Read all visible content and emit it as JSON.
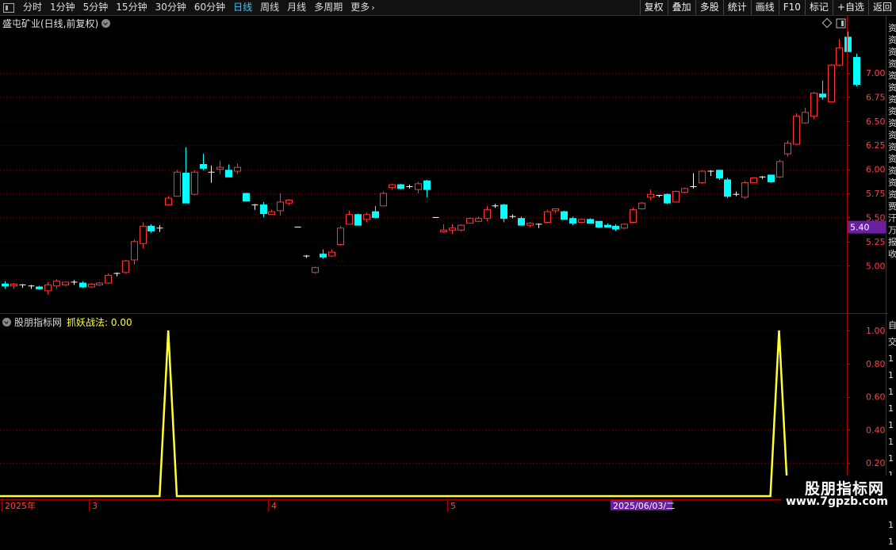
{
  "toolbar": {
    "periods": [
      "分时",
      "1分钟",
      "5分钟",
      "15分钟",
      "30分钟",
      "60分钟",
      "日线",
      "周线",
      "月线",
      "多周期",
      "更多"
    ],
    "active_period": "日线",
    "tools": [
      "复权",
      "叠加",
      "多股",
      "统计",
      "画线",
      "F10",
      "标记",
      "+自选",
      "返回"
    ]
  },
  "main_panel": {
    "title": "盛屯矿业(日线,前复权)",
    "price_axis_labels": [
      "7.00",
      "6.75",
      "6.50",
      "6.25",
      "6.00",
      "5.75",
      "5.50",
      "5.25",
      "5.00"
    ],
    "current_price_tag": "5.40"
  },
  "indicator_panel": {
    "name": "股朋指标网",
    "value_label": "抓妖战法: 0.00",
    "axis_labels": [
      "1.00",
      "0.80",
      "0.60",
      "0.40",
      "0.20"
    ]
  },
  "date_axis": {
    "labels": [
      "2025年",
      "3",
      "4",
      "5"
    ],
    "cursor_date": "2025/06/03/二"
  },
  "watermark": {
    "line1": "股朋指标网",
    "line2": "www.7gpzb.com"
  },
  "side_column": {
    "top_chars": [
      "资",
      "资",
      "资",
      "资",
      "资",
      "资",
      "资",
      "资",
      "资",
      "资",
      "资",
      "资",
      "资",
      "资",
      "资",
      "贾",
      "汗",
      "万",
      "报",
      "收"
    ],
    "indicator_chars": [
      "自",
      "交",
      "1",
      "1",
      "1",
      "1",
      "1",
      "1",
      "1",
      "1",
      "1",
      "1",
      "1",
      "1"
    ]
  },
  "colors": {
    "up": "#ff3333",
    "down": "#00ffff",
    "indicator_line": "#ffff33",
    "grid": "#5a0000",
    "axis": "#aa0000",
    "price_tag_bg": "#6a1fa0"
  },
  "chart_data": [
    {
      "type": "candlestick",
      "title": "盛屯矿业(日线,前复权)",
      "ylim": [
        4.55,
        7.55
      ],
      "y_ticks": [
        5.0,
        5.25,
        5.5,
        5.75,
        6.0,
        6.25,
        6.5,
        6.75,
        7.0
      ],
      "x_tick_labels": [
        "2025年",
        "3",
        "4",
        "5"
      ],
      "candles": [
        {
          "o": 4.81,
          "h": 4.84,
          "l": 4.76,
          "c": 4.79
        },
        {
          "o": 4.79,
          "h": 4.82,
          "l": 4.76,
          "c": 4.81
        },
        {
          "o": 4.79,
          "h": 4.81,
          "l": 4.77,
          "c": 4.8
        },
        {
          "o": 4.78,
          "h": 4.8,
          "l": 4.76,
          "c": 4.79
        },
        {
          "o": 4.78,
          "h": 4.79,
          "l": 4.75,
          "c": 4.76
        },
        {
          "o": 4.74,
          "h": 4.83,
          "l": 4.7,
          "c": 4.8
        },
        {
          "o": 4.79,
          "h": 4.86,
          "l": 4.76,
          "c": 4.84
        },
        {
          "o": 4.8,
          "h": 4.83,
          "l": 4.79,
          "c": 4.83
        },
        {
          "o": 4.83,
          "h": 4.85,
          "l": 4.8,
          "c": 4.82
        },
        {
          "o": 4.82,
          "h": 4.84,
          "l": 4.77,
          "c": 4.78
        },
        {
          "o": 4.78,
          "h": 4.82,
          "l": 4.77,
          "c": 4.81
        },
        {
          "o": 4.8,
          "h": 4.83,
          "l": 4.79,
          "c": 4.82
        },
        {
          "o": 4.82,
          "h": 4.92,
          "l": 4.81,
          "c": 4.9
        },
        {
          "o": 4.91,
          "h": 4.93,
          "l": 4.89,
          "c": 4.92
        },
        {
          "o": 4.93,
          "h": 5.06,
          "l": 4.92,
          "c": 5.05
        },
        {
          "o": 5.06,
          "h": 5.27,
          "l": 5.01,
          "c": 5.25
        },
        {
          "o": 5.23,
          "h": 5.45,
          "l": 5.18,
          "c": 5.41
        },
        {
          "o": 5.41,
          "h": 5.43,
          "l": 5.34,
          "c": 5.36
        },
        {
          "o": 5.38,
          "h": 5.42,
          "l": 5.35,
          "c": 5.39
        },
        {
          "o": 5.63,
          "h": 5.72,
          "l": 5.63,
          "c": 5.7
        },
        {
          "o": 5.72,
          "h": 5.99,
          "l": 5.72,
          "c": 5.97
        },
        {
          "o": 5.96,
          "h": 6.23,
          "l": 5.65,
          "c": 5.65
        },
        {
          "o": 5.74,
          "h": 5.99,
          "l": 5.73,
          "c": 5.97
        },
        {
          "o": 6.05,
          "h": 6.16,
          "l": 5.99,
          "c": 6.01
        },
        {
          "o": 5.97,
          "h": 6.04,
          "l": 5.86,
          "c": 5.96
        },
        {
          "o": 6.0,
          "h": 6.09,
          "l": 5.95,
          "c": 6.02
        },
        {
          "o": 5.99,
          "h": 6.05,
          "l": 5.93,
          "c": 5.92
        },
        {
          "o": 5.98,
          "h": 6.06,
          "l": 5.95,
          "c": 6.02
        },
        {
          "o": 5.75,
          "h": 5.75,
          "l": 5.67,
          "c": 5.67
        },
        {
          "o": 5.62,
          "h": 5.64,
          "l": 5.58,
          "c": 5.63
        },
        {
          "o": 5.63,
          "h": 5.66,
          "l": 5.5,
          "c": 5.54
        },
        {
          "o": 5.53,
          "h": 5.58,
          "l": 5.53,
          "c": 5.56
        },
        {
          "o": 5.57,
          "h": 5.75,
          "l": 5.52,
          "c": 5.66
        },
        {
          "o": 5.65,
          "h": 5.69,
          "l": 5.63,
          "c": 5.68
        },
        {
          "o": 5.4,
          "h": 5.4,
          "l": 5.4,
          "c": 5.4
        },
        {
          "o": 5.1,
          "h": 5.11,
          "l": 5.08,
          "c": 5.09
        },
        {
          "o": 4.93,
          "h": 4.99,
          "l": 4.92,
          "c": 4.98
        },
        {
          "o": 5.12,
          "h": 5.17,
          "l": 5.07,
          "c": 5.09
        },
        {
          "o": 5.1,
          "h": 5.17,
          "l": 5.09,
          "c": 5.14
        },
        {
          "o": 5.22,
          "h": 5.41,
          "l": 5.21,
          "c": 5.39
        },
        {
          "o": 5.43,
          "h": 5.57,
          "l": 5.43,
          "c": 5.53
        },
        {
          "o": 5.53,
          "h": 5.54,
          "l": 5.42,
          "c": 5.42
        },
        {
          "o": 5.48,
          "h": 5.55,
          "l": 5.45,
          "c": 5.53
        },
        {
          "o": 5.56,
          "h": 5.62,
          "l": 5.49,
          "c": 5.5
        },
        {
          "o": 5.62,
          "h": 5.77,
          "l": 5.62,
          "c": 5.75
        },
        {
          "o": 5.81,
          "h": 5.85,
          "l": 5.79,
          "c": 5.84
        },
        {
          "o": 5.84,
          "h": 5.85,
          "l": 5.79,
          "c": 5.8
        },
        {
          "o": 5.81,
          "h": 5.84,
          "l": 5.8,
          "c": 5.82
        },
        {
          "o": 5.79,
          "h": 5.87,
          "l": 5.75,
          "c": 5.85
        },
        {
          "o": 5.88,
          "h": 5.89,
          "l": 5.71,
          "c": 5.79
        },
        {
          "o": 5.5,
          "h": 5.5,
          "l": 5.5,
          "c": 5.5
        },
        {
          "o": 5.35,
          "h": 5.43,
          "l": 5.34,
          "c": 5.37
        },
        {
          "o": 5.37,
          "h": 5.43,
          "l": 5.33,
          "c": 5.39
        },
        {
          "o": 5.37,
          "h": 5.43,
          "l": 5.36,
          "c": 5.42
        },
        {
          "o": 5.44,
          "h": 5.5,
          "l": 5.44,
          "c": 5.49
        },
        {
          "o": 5.46,
          "h": 5.51,
          "l": 5.45,
          "c": 5.49
        },
        {
          "o": 5.49,
          "h": 5.62,
          "l": 5.46,
          "c": 5.58
        },
        {
          "o": 5.61,
          "h": 5.64,
          "l": 5.6,
          "c": 5.62
        },
        {
          "o": 5.63,
          "h": 5.64,
          "l": 5.45,
          "c": 5.49
        },
        {
          "o": 5.51,
          "h": 5.53,
          "l": 5.49,
          "c": 5.5
        },
        {
          "o": 5.49,
          "h": 5.51,
          "l": 5.42,
          "c": 5.42
        },
        {
          "o": 5.42,
          "h": 5.45,
          "l": 5.4,
          "c": 5.44
        },
        {
          "o": 5.43,
          "h": 5.44,
          "l": 5.39,
          "c": 5.42
        },
        {
          "o": 5.45,
          "h": 5.58,
          "l": 5.44,
          "c": 5.56
        },
        {
          "o": 5.57,
          "h": 5.59,
          "l": 5.55,
          "c": 5.59
        },
        {
          "o": 5.56,
          "h": 5.57,
          "l": 5.48,
          "c": 5.48
        },
        {
          "o": 5.49,
          "h": 5.51,
          "l": 5.42,
          "c": 5.44
        },
        {
          "o": 5.45,
          "h": 5.49,
          "l": 5.44,
          "c": 5.48
        },
        {
          "o": 5.48,
          "h": 5.49,
          "l": 5.44,
          "c": 5.44
        },
        {
          "o": 5.46,
          "h": 5.46,
          "l": 5.39,
          "c": 5.4
        },
        {
          "o": 5.42,
          "h": 5.44,
          "l": 5.4,
          "c": 5.4
        },
        {
          "o": 5.41,
          "h": 5.43,
          "l": 5.36,
          "c": 5.38
        },
        {
          "o": 5.39,
          "h": 5.44,
          "l": 5.38,
          "c": 5.43
        },
        {
          "o": 5.45,
          "h": 5.6,
          "l": 5.44,
          "c": 5.58
        },
        {
          "o": 5.59,
          "h": 5.66,
          "l": 5.58,
          "c": 5.65
        },
        {
          "o": 5.71,
          "h": 5.79,
          "l": 5.68,
          "c": 5.74
        },
        {
          "o": 5.72,
          "h": 5.73,
          "l": 5.71,
          "c": 5.73
        },
        {
          "o": 5.74,
          "h": 5.75,
          "l": 5.64,
          "c": 5.65
        },
        {
          "o": 5.66,
          "h": 5.78,
          "l": 5.66,
          "c": 5.77
        },
        {
          "o": 5.76,
          "h": 5.81,
          "l": 5.75,
          "c": 5.8
        },
        {
          "o": 5.81,
          "h": 5.96,
          "l": 5.8,
          "c": 5.82
        },
        {
          "o": 5.86,
          "h": 5.99,
          "l": 5.85,
          "c": 5.98
        },
        {
          "o": 5.97,
          "h": 5.99,
          "l": 5.93,
          "c": 5.98
        },
        {
          "o": 5.99,
          "h": 5.99,
          "l": 5.89,
          "c": 5.91
        },
        {
          "o": 5.89,
          "h": 5.91,
          "l": 5.7,
          "c": 5.72
        },
        {
          "o": 5.74,
          "h": 5.77,
          "l": 5.72,
          "c": 5.74
        },
        {
          "o": 5.71,
          "h": 5.88,
          "l": 5.69,
          "c": 5.86
        },
        {
          "o": 5.86,
          "h": 5.92,
          "l": 5.86,
          "c": 5.91
        },
        {
          "o": 5.91,
          "h": 5.93,
          "l": 5.9,
          "c": 5.92
        },
        {
          "o": 5.94,
          "h": 5.94,
          "l": 5.86,
          "c": 5.87
        },
        {
          "o": 5.92,
          "h": 6.1,
          "l": 5.91,
          "c": 6.08
        },
        {
          "o": 6.16,
          "h": 6.3,
          "l": 6.13,
          "c": 6.27
        },
        {
          "o": 6.26,
          "h": 6.58,
          "l": 6.25,
          "c": 6.55
        },
        {
          "o": 6.48,
          "h": 6.64,
          "l": 6.47,
          "c": 6.59
        },
        {
          "o": 6.55,
          "h": 6.8,
          "l": 6.52,
          "c": 6.79
        },
        {
          "o": 6.78,
          "h": 6.92,
          "l": 6.72,
          "c": 6.75
        },
        {
          "o": 6.7,
          "h": 7.09,
          "l": 6.7,
          "c": 7.08
        },
        {
          "o": 7.08,
          "h": 7.35,
          "l": 7.07,
          "c": 7.26
        },
        {
          "o": 7.37,
          "h": 7.43,
          "l": 7.22,
          "c": 7.22
        },
        {
          "o": 7.16,
          "h": 7.2,
          "l": 6.86,
          "c": 6.88
        }
      ]
    },
    {
      "type": "line",
      "title": "抓妖战法: 0.00",
      "ylim": [
        0,
        1.0
      ],
      "y_ticks": [
        0.2,
        0.4,
        0.6,
        0.8,
        1.0
      ],
      "x": [
        0,
        18,
        19,
        20,
        89,
        90,
        91,
        95
      ],
      "values": [
        0,
        0,
        1.0,
        0,
        0,
        1.0,
        0,
        0
      ]
    }
  ]
}
